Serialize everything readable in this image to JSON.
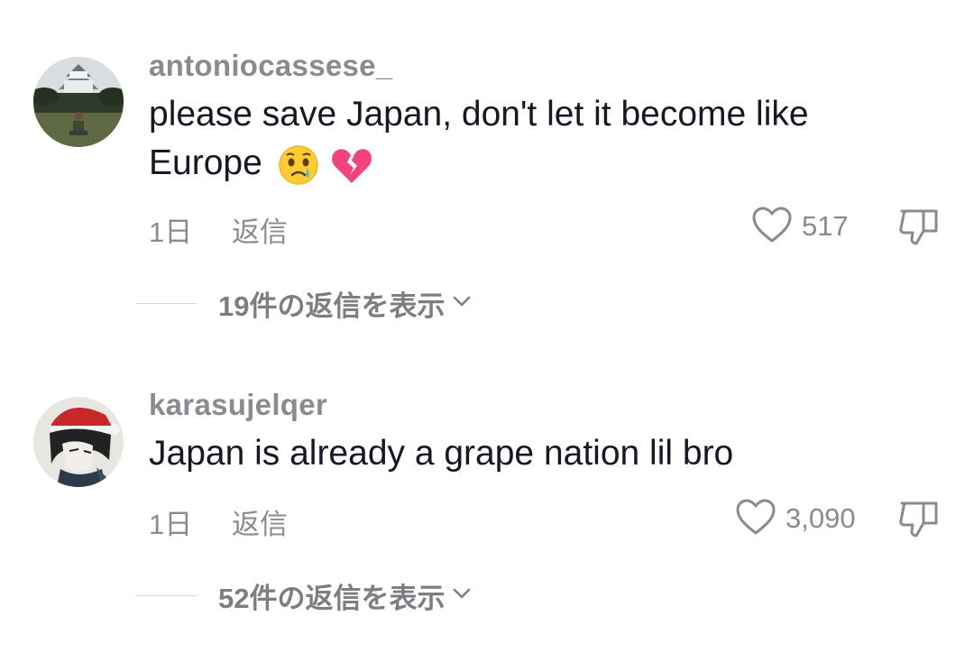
{
  "comments": [
    {
      "username": "antoniocassese_",
      "text": "please save Japan, don't let it become like Europe",
      "emojis": [
        "crying-face",
        "broken-heart"
      ],
      "time": "1日",
      "reply_label": "返信",
      "likes": "517",
      "view_replies_label": "19件の返信を表示"
    },
    {
      "username": "karasujelqer",
      "text": "Japan is already a grape nation lil bro",
      "emojis": [],
      "time": "1日",
      "reply_label": "返信",
      "likes": "3,090",
      "view_replies_label": "52件の返信を表示"
    }
  ],
  "icons": {
    "like": "heart-outline-icon",
    "dislike": "thumbs-down-outline-icon",
    "expand": "chevron-down-icon"
  },
  "colors": {
    "primary_text": "#161823",
    "secondary_text": "#8a8b91",
    "divider": "#d8d8da"
  }
}
